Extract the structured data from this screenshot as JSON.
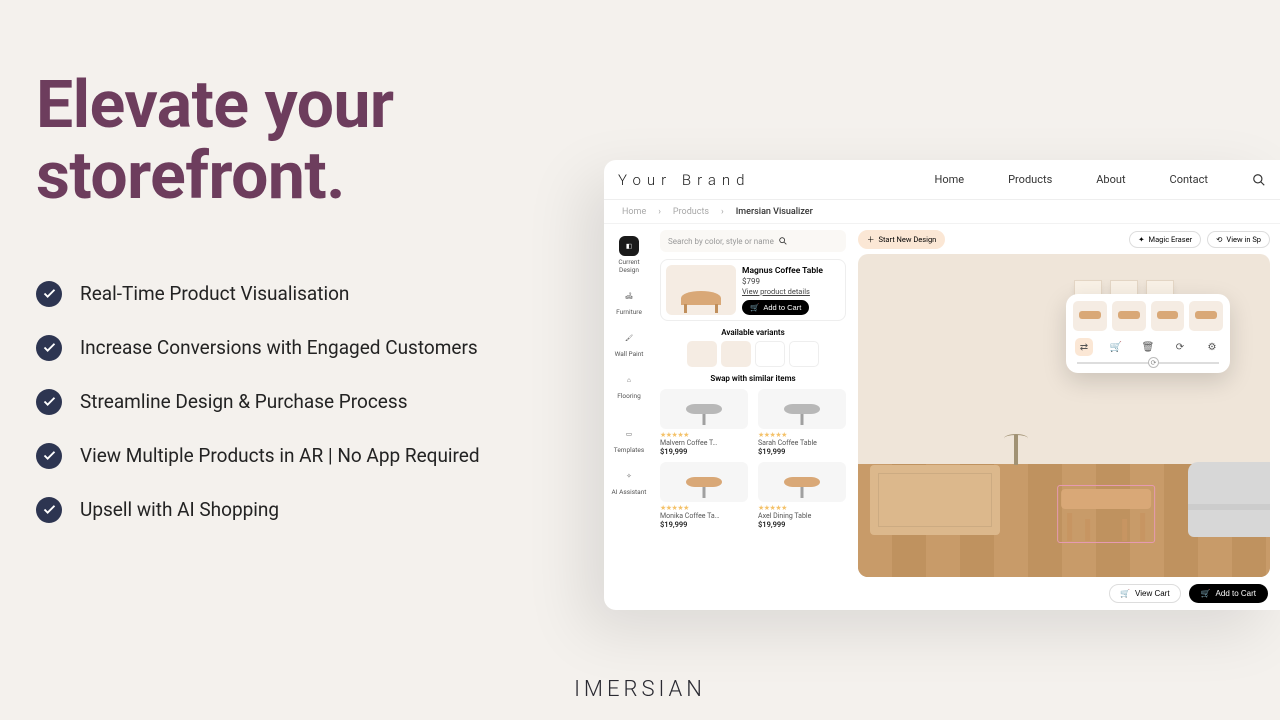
{
  "headline": "Elevate your storefront.",
  "features": [
    "Real-Time Product Visualisation",
    "Increase Conversions with Engaged Customers",
    "Streamline Design & Purchase Process",
    "View Multiple Products in AR | No App Required",
    "Upsell with AI Shopping"
  ],
  "logo_text": "IMERSIAN",
  "app": {
    "brand": "Your Brand",
    "nav": [
      "Home",
      "Products",
      "About",
      "Contact"
    ],
    "breadcrumb": {
      "items": [
        "Home",
        "Products"
      ],
      "current": "Imersian Visualizer"
    },
    "search_placeholder": "Search by color, style or name",
    "sidebar": [
      {
        "label": "Current Design"
      },
      {
        "label": "Furniture"
      },
      {
        "label": "Wall Paint"
      },
      {
        "label": "Flooring"
      },
      {
        "label": "Templates"
      },
      {
        "label": "AI Assistant"
      }
    ],
    "product": {
      "name": "Magnus Coffee Table",
      "price": "$799",
      "view_details": "View product details",
      "add_btn": "Add to Cart"
    },
    "variants_title": "Available variants",
    "swap_title": "Swap with similar items",
    "similar": [
      {
        "name": "Malvern Coffee T…",
        "price": "$19,999"
      },
      {
        "name": "Sarah Coffee Table",
        "price": "$19,999"
      },
      {
        "name": "Monika Coffee Ta…",
        "price": "$19,999"
      },
      {
        "name": "Axel Dining Table",
        "price": "$19,999"
      }
    ],
    "canvas_buttons": {
      "start_new": "Start New Design",
      "magic": "Magic Eraser",
      "view_space": "View in Sp"
    },
    "bottom": {
      "view_cart": "View Cart",
      "add_cart": "Add to Cart"
    }
  }
}
